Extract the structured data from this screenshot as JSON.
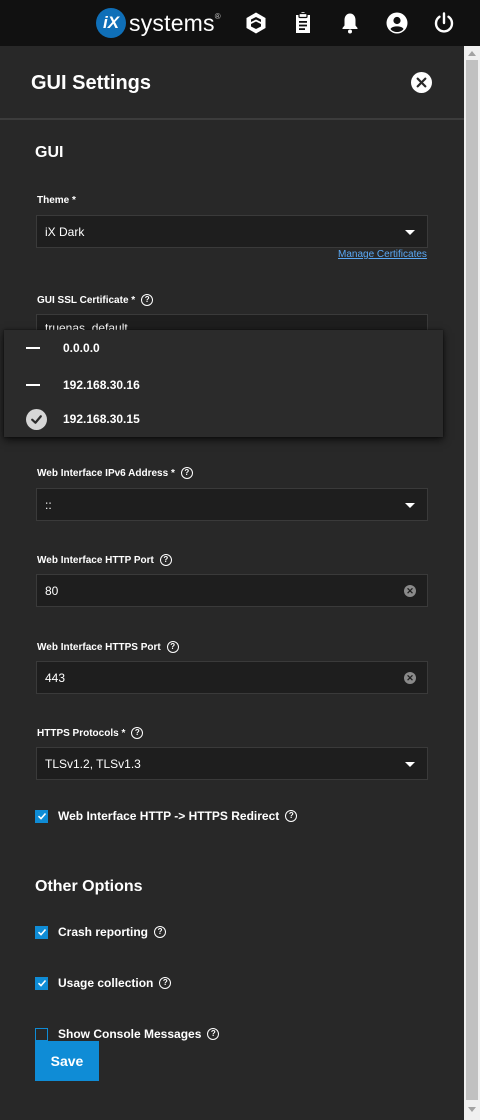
{
  "header": {
    "logo_mark": "iX",
    "logo_text": "systems",
    "logo_tm": "®",
    "icons": [
      "truecommand-icon",
      "clipboard-icon",
      "bell-icon",
      "account-icon",
      "power-icon"
    ]
  },
  "panel": {
    "title": "GUI Settings",
    "close_icon": "close-icon"
  },
  "gui": {
    "section_title": "GUI",
    "theme": {
      "label": "Theme *",
      "value": "iX Dark"
    },
    "ssl": {
      "label": "GUI SSL Certificate *",
      "value": "truenas_default",
      "manage_link": "Manage Certificates"
    },
    "ipv4_options": [
      {
        "text": "0.0.0.0",
        "state": "partial"
      },
      {
        "text": "192.168.30.16",
        "state": "partial"
      },
      {
        "text": "192.168.30.15",
        "state": "checked"
      }
    ],
    "ipv6": {
      "label": "Web Interface IPv6 Address *",
      "value": "::"
    },
    "http_port": {
      "label": "Web Interface HTTP Port",
      "value": "80"
    },
    "https_port": {
      "label": "Web Interface HTTPS Port",
      "value": "443"
    },
    "protocols": {
      "label": "HTTPS Protocols *",
      "value": "TLSv1.2, TLSv1.3"
    },
    "redirect": {
      "label": "Web Interface HTTP -> HTTPS Redirect",
      "checked": true
    }
  },
  "other": {
    "section_title": "Other Options",
    "crash": {
      "label": "Crash reporting",
      "checked": true
    },
    "usage": {
      "label": "Usage collection",
      "checked": true
    },
    "console": {
      "label": "Show Console Messages",
      "checked": false
    }
  },
  "actions": {
    "save_label": "Save"
  },
  "colors": {
    "accent": "#0f8cd6",
    "topbar": "#111111",
    "panel": "#282828",
    "field": "#1e1e1e",
    "link": "#5aa9f5"
  }
}
